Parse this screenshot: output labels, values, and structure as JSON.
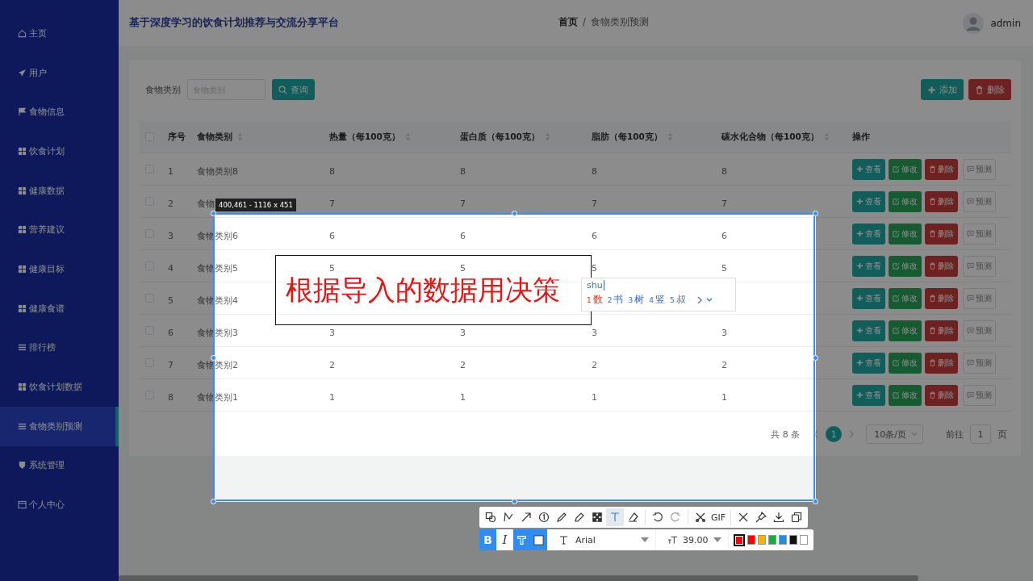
{
  "app_title": "基于深度学习的饮食计划推荐与交流分享平台",
  "sidebar": {
    "items": [
      {
        "label": "主页",
        "selected": false
      },
      {
        "label": "用户",
        "selected": false
      },
      {
        "label": "食物信息",
        "selected": false
      },
      {
        "label": "饮食计划",
        "selected": false
      },
      {
        "label": "健康数据",
        "selected": false
      },
      {
        "label": "营养建议",
        "selected": false
      },
      {
        "label": "健康目标",
        "selected": false
      },
      {
        "label": "健康食谱",
        "selected": false
      },
      {
        "label": "排行榜",
        "selected": false
      },
      {
        "label": "饮食计划数据",
        "selected": false
      },
      {
        "label": "食物类别预测",
        "selected": true
      },
      {
        "label": "系统管理",
        "selected": false
      },
      {
        "label": "个人中心",
        "selected": false
      }
    ]
  },
  "breadcrumb": [
    "首页",
    "食物类别预测"
  ],
  "breadcrumb_separator": "/",
  "user": {
    "name": "admin"
  },
  "search": {
    "label": "食物类别",
    "placeholder": "食物类别",
    "button": "查询"
  },
  "toolbar_buttons": [
    "添加",
    "删除"
  ],
  "table": {
    "all_checked": false,
    "columns": [
      {
        "label": "序号",
        "sortable": false
      },
      {
        "label": "食物类别",
        "sortable": true
      },
      {
        "label": "热量（每100克）",
        "sortable": true
      },
      {
        "label": "蛋白质（每100克）",
        "sortable": true
      },
      {
        "label": "脂肪（每100克）",
        "sortable": true
      },
      {
        "label": "碳水化合物（每100克）",
        "sortable": true
      },
      {
        "label": "操作",
        "sortable": false
      }
    ],
    "rows": [
      {
        "index": "1",
        "category": "食物类别8",
        "heat": "8",
        "protein": "8",
        "fat": "8",
        "carbs": "8",
        "checked": false,
        "actions": [
          "查看",
          "修改",
          "删除",
          "预测"
        ]
      },
      {
        "index": "2",
        "category": "食物",
        "heat": "7",
        "protein": "7",
        "fat": "7",
        "carbs": "7",
        "checked": false,
        "actions": [
          "查看",
          "修改",
          "删除",
          "预测"
        ]
      },
      {
        "index": "3",
        "category": "食物类别6",
        "heat": "6",
        "protein": "6",
        "fat": "6",
        "carbs": "6",
        "checked": false,
        "actions": [
          "查看",
          "修改",
          "删除",
          "预测"
        ]
      },
      {
        "index": "4",
        "category": "食物类别5",
        "heat": "5",
        "protein": "5",
        "fat": "5",
        "carbs": "5",
        "checked": false,
        "actions": [
          "查看",
          "修改",
          "删除",
          "预测"
        ]
      },
      {
        "index": "5",
        "category": "食物类别4",
        "checked": false,
        "actions": [
          "查看",
          "修改",
          "删除",
          "预测"
        ]
      },
      {
        "index": "6",
        "category": "食物类别3",
        "heat": "3",
        "protein": "3",
        "fat": "3",
        "carbs": "3",
        "checked": false,
        "actions": [
          "查看",
          "修改",
          "删除",
          "预测"
        ]
      },
      {
        "index": "7",
        "category": "食物类别2",
        "heat": "2",
        "protein": "2",
        "fat": "2",
        "carbs": "2",
        "checked": false,
        "actions": [
          "查看",
          "修改",
          "删除",
          "预测"
        ]
      },
      {
        "index": "8",
        "category": "食物类别1",
        "heat": "1",
        "protein": "1",
        "fat": "1",
        "carbs": "1",
        "checked": false,
        "actions": [
          "查看",
          "修改",
          "删除",
          "预测"
        ]
      }
    ]
  },
  "pagination": {
    "total": "共 8 条",
    "pages": [
      {
        "label": "1",
        "selected": true
      }
    ],
    "page_size": "10条/页",
    "goto_label": "前往",
    "goto_value": "1",
    "goto_suffix": "页"
  },
  "capture": {
    "size_label": "400,461 - 1116 x 451",
    "annotation": "根据导入的数据用决策",
    "ime": {
      "input": "shu",
      "candidates": [
        {
          "number": "1",
          "text": "数",
          "selected": true
        },
        {
          "number": "2",
          "text": "书",
          "selected": false
        },
        {
          "number": "3",
          "text": "树",
          "selected": false
        },
        {
          "number": "4",
          "text": "竖",
          "selected": false
        },
        {
          "number": "5",
          "text": "叔",
          "selected": false
        }
      ]
    },
    "tools": [
      [
        {
          "selected": false
        },
        {
          "selected": false
        },
        {
          "selected": false
        },
        {
          "selected": false
        },
        {
          "selected": false
        },
        {
          "selected": false
        },
        {
          "selected": false
        },
        {
          "selected": true
        },
        {
          "selected": false
        }
      ],
      [
        {
          "selected": false
        },
        {
          "selected": false
        }
      ],
      [
        {
          "selected": false
        },
        {
          "label": "GIF",
          "selected": false
        }
      ],
      [
        {
          "selected": false
        },
        {
          "selected": false
        },
        {
          "selected": false
        },
        {
          "selected": false
        }
      ]
    ],
    "format": [
      {
        "label": "B",
        "selected": true
      },
      {
        "label": "I",
        "selected": false
      },
      {
        "selected": true
      },
      {
        "selected": true
      }
    ],
    "font": "Arial",
    "size": "39.00",
    "colors": [
      {
        "color": "#ff0000",
        "selected": true
      },
      {
        "color": "#ff0000",
        "selected": false
      },
      {
        "color": "#f5b400",
        "selected": false
      },
      {
        "color": "#1aab40",
        "selected": false
      },
      {
        "color": "#1e90e0",
        "selected": false
      },
      {
        "color": "#111111",
        "selected": false
      },
      {
        "color": "#ffffff",
        "selected": false
      }
    ]
  }
}
